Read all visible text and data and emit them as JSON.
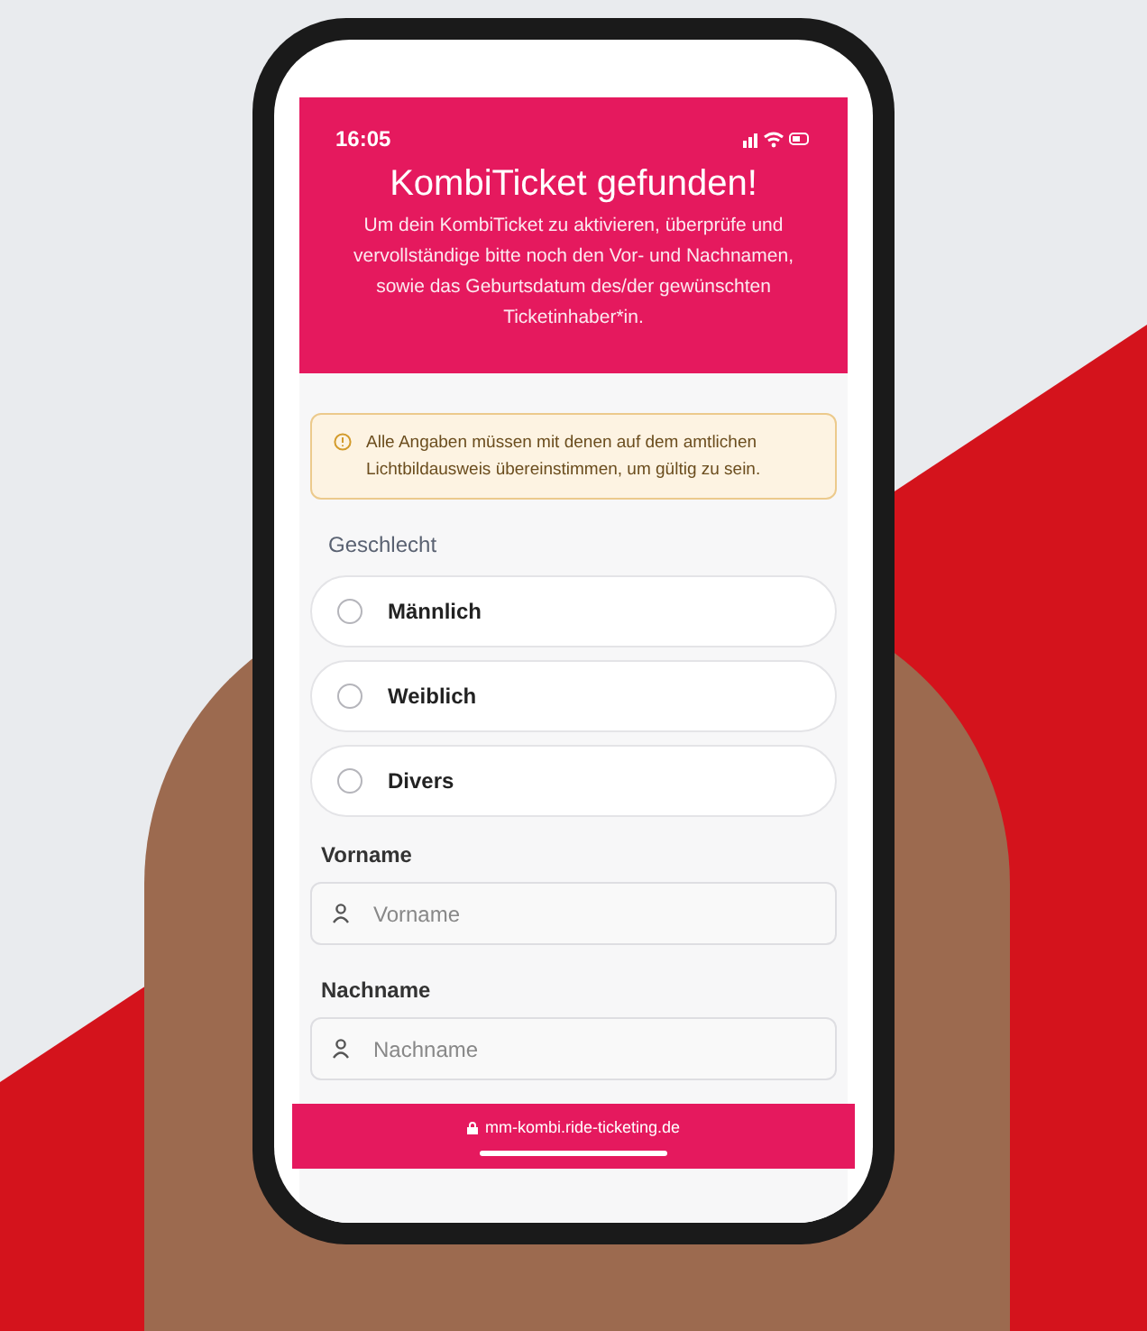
{
  "status_bar": {
    "time": "16:05"
  },
  "header": {
    "title": "KombiTicket gefunden!",
    "description": "Um dein KombiTicket zu aktivieren, überprüfe und vervollständige bitte noch den Vor- und Nachnamen, sowie das Geburtsdatum des/der gewünschten Ticketinhaber*in."
  },
  "notice": "Alle Angaben müssen mit denen auf dem amtlichen Lichtbildausweis übereinstimmen, um gültig zu sein.",
  "gender": {
    "label": "Geschlecht",
    "options": [
      {
        "label": "Männlich",
        "selected": false
      },
      {
        "label": "Weiblich",
        "selected": false
      },
      {
        "label": "Divers",
        "selected": false
      }
    ]
  },
  "fields": [
    {
      "label": "Vorname",
      "placeholder": "Vorname"
    },
    {
      "label": "Nachname",
      "placeholder": "Nachname"
    }
  ],
  "address_bar": {
    "url": "mm-kombi.ride-ticketing.de"
  }
}
